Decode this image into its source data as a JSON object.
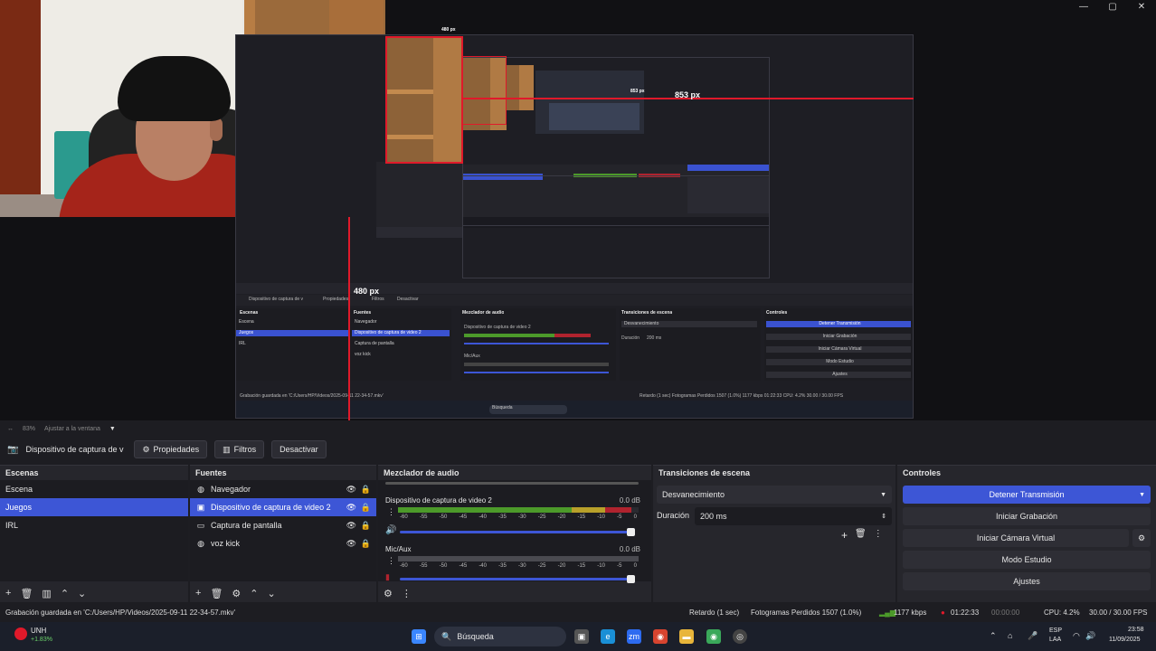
{
  "window": {
    "minimize": "—",
    "maximize": "▢",
    "close": "✕"
  },
  "preview": {
    "px_labels": [
      "853 px",
      "480 px",
      "853 px",
      "480 px",
      "853 px"
    ],
    "inner": {
      "source_name": "Dispositivo de captura de v",
      "props": "Propiedades",
      "filters": "Filtros",
      "deactivate": "Desactivar",
      "scenes_title": "Escenas",
      "scenes": [
        "Escena",
        "Juegos",
        "IRL"
      ],
      "sources_title": "Fuentes",
      "sources": [
        "Navegador",
        "Dispositivo de captura de video 2",
        "Captura de pantalla",
        "voz kick"
      ],
      "mixer_title": "Mezclador de audio",
      "mixer_ch1": "Dispositivo de captura de video 2",
      "mixer_ch2": "Mic/Aux",
      "trans_title": "Transiciones de escena",
      "trans_value": "Desvanecimiento",
      "dur_label": "Duración",
      "dur_value": "200 ms",
      "ctl_title": "Controles",
      "ctl": [
        "Detener Transmisión",
        "Iniciar Grabación",
        "Iniciar Cámara Virtual",
        "Modo Estudio",
        "Ajustes"
      ],
      "status_left": "Grabación guardada en 'C:/Users/HP/Videos/2025-09-11 22-34-57.mkv'",
      "status_right": "Retardo (1 sec)   Fotogramas Perdidos 1507 (1.0%)   1177 kbps   01:22:33   CPU: 4.2%   30.00 / 30.00 FPS",
      "search": "Búsqueda"
    }
  },
  "zoom": {
    "percent": "83%",
    "fit": "Ajustar a la ventana"
  },
  "source_toolbar": {
    "source_name": "Dispositivo de captura de v",
    "properties": "Propiedades",
    "filters": "Filtros",
    "deactivate": "Desactivar"
  },
  "scenes": {
    "title": "Escenas",
    "items": [
      {
        "label": "Escena"
      },
      {
        "label": "Juegos",
        "selected": true
      },
      {
        "label": "IRL"
      }
    ]
  },
  "sources": {
    "title": "Fuentes",
    "items": [
      {
        "label": "Navegador",
        "icon": "globe-icon"
      },
      {
        "label": "Dispositivo de captura de video 2",
        "icon": "camera-icon",
        "selected": true
      },
      {
        "label": "Captura de pantalla",
        "icon": "monitor-icon"
      },
      {
        "label": "voz kick",
        "icon": "globe-icon"
      }
    ]
  },
  "mixer": {
    "title": "Mezclador de audio",
    "channels": [
      {
        "name": "Dispositivo de captura de video 2",
        "db": "0.0 dB",
        "level": 0.97
      },
      {
        "name": "Mic/Aux",
        "db": "0.0 dB",
        "level": 0.0
      }
    ],
    "scale": [
      "-60",
      "-55",
      "-50",
      "-45",
      "-40",
      "-35",
      "-30",
      "-25",
      "-20",
      "-15",
      "-10",
      "-5",
      "0"
    ]
  },
  "transitions": {
    "title": "Transiciones de escena",
    "type": "Desvanecimiento",
    "duration_label": "Duración",
    "duration_value": "200 ms"
  },
  "controls": {
    "title": "Controles",
    "stop_stream": "Detener Transmisión",
    "start_recording": "Iniciar Grabación",
    "start_virtual_cam": "Iniciar Cámara Virtual",
    "studio_mode": "Modo Estudio",
    "settings": "Ajustes"
  },
  "status": {
    "message": "Grabación guardada en 'C:/Users/HP/Videos/2025-09-11 22-34-57.mkv'",
    "delay": "Retardo (1 sec)",
    "dropped": "Fotogramas Perdidos 1507 (1.0%)",
    "bitrate": "1177 kbps",
    "stream_time": "01:22:33",
    "rec_time": "00:00:00",
    "cpu": "CPU: 4.2%",
    "fps": "30.00 / 30.00 FPS"
  },
  "taskbar": {
    "stock_name": "UNH",
    "stock_change": "+1.83%",
    "search": "Búsqueda",
    "lang": "ESP",
    "lang2": "LAA",
    "time": "23:58",
    "date": "11/09/2025"
  },
  "colors": {
    "accent": "#3d56d6",
    "red": "#e0192a",
    "meter_green": "#4c9a2a",
    "meter_yellow": "#b8a02a",
    "meter_red": "#b0232e"
  }
}
